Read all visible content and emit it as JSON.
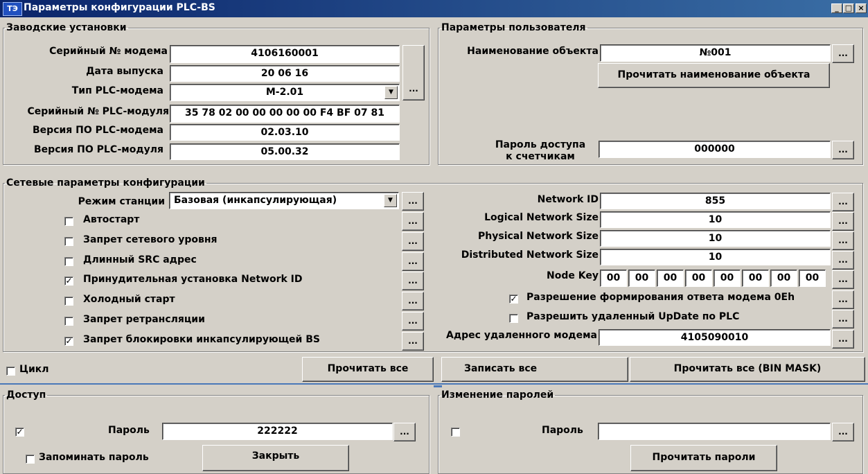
{
  "window": {
    "title": "Параметры конфигурации PLC-BS",
    "logo": "ТЭ",
    "minimize_label": "_",
    "maximize_label": "□",
    "close_label": "×"
  },
  "factory": {
    "legend": "Заводские установки",
    "serial_modem_label": "Серийный № модема",
    "serial_modem_value": "4106160001",
    "release_date_label": "Дата выпуска",
    "release_date_value": "20 06 16",
    "modem_type_label": "Тип PLC-модема",
    "modem_type_value": "M-2.01",
    "serial_module_label": "Серийный № PLC-модуля",
    "serial_module_value": "35 78 02 00 00 00 00 00 F4 BF 07 81",
    "fw_modem_label": "Версия ПО PLC-модема",
    "fw_modem_value": "02.03.10",
    "fw_module_label": "Версия ПО PLC-модуля",
    "fw_module_value": "05.00.32",
    "dots": "..."
  },
  "user": {
    "legend": "Параметры пользователя",
    "object_name_label": "Наименование объекта",
    "object_name_value": "№001",
    "read_object_name_button": "Прочитать наименование объекта",
    "meter_password_label_1": "Пароль доступа",
    "meter_password_label_2": "к счетчикам",
    "meter_password_value": "000000",
    "dots": "..."
  },
  "network": {
    "legend": "Сетевые параметры конфигурации",
    "station_mode_label": "Режим станции",
    "station_mode_value": "Базовая (инкапсулирующая)",
    "checkboxes": [
      {
        "label": "Автостарт",
        "checked": false,
        "mark": ""
      },
      {
        "label": "Запрет сетевого уровня",
        "checked": false,
        "mark": ""
      },
      {
        "label": "Длинный SRC адрес",
        "checked": false,
        "mark": ""
      },
      {
        "label": "Принудительная установка Network ID",
        "checked": true,
        "mark": "✓"
      },
      {
        "label": "Холодный старт",
        "checked": false,
        "mark": ""
      },
      {
        "label": "Запрет ретрансляции",
        "checked": false,
        "mark": ""
      },
      {
        "label": "Запрет блокировки инкапсулирующей BS",
        "checked": true,
        "mark": "✓"
      }
    ],
    "network_id_label": "Network ID",
    "network_id_value": "855",
    "logical_size_label": "Logical Network Size",
    "logical_size_value": "10",
    "physical_size_label": "Physical Network Size",
    "physical_size_value": "10",
    "distributed_size_label": "Distributed Network Size",
    "distributed_size_value": "10",
    "node_key_label": "Node Key",
    "node_key_bytes": [
      "00",
      "00",
      "00",
      "00",
      "00",
      "00",
      "00",
      "00"
    ],
    "allow_response_label": "Разрешение формирования ответа модема 0Eh",
    "allow_response_mark": "✓",
    "allow_update_label": "Разрешить удаленный UpDate по PLC",
    "allow_update_mark": "",
    "remote_modem_label": "Адрес удаленного модема",
    "remote_modem_value": "4105090010",
    "dots": "..."
  },
  "actions": {
    "cycle_label": "Цикл",
    "read_all": "Прочитать все",
    "write_all": "Записать все",
    "read_all_bin": "Прочитать все (BIN MASK)"
  },
  "access": {
    "legend": "Доступ",
    "password_label": "Пароль",
    "password_value": "222222",
    "checkbox_mark": "✓",
    "remember_label": "Запоминать пароль",
    "close_button": "Закрыть",
    "dots": "..."
  },
  "change_passwords": {
    "legend": "Изменение паролей",
    "password_label": "Пароль",
    "password_value": "",
    "read_passwords_button": "Прочитать пароли",
    "dots": "..."
  }
}
